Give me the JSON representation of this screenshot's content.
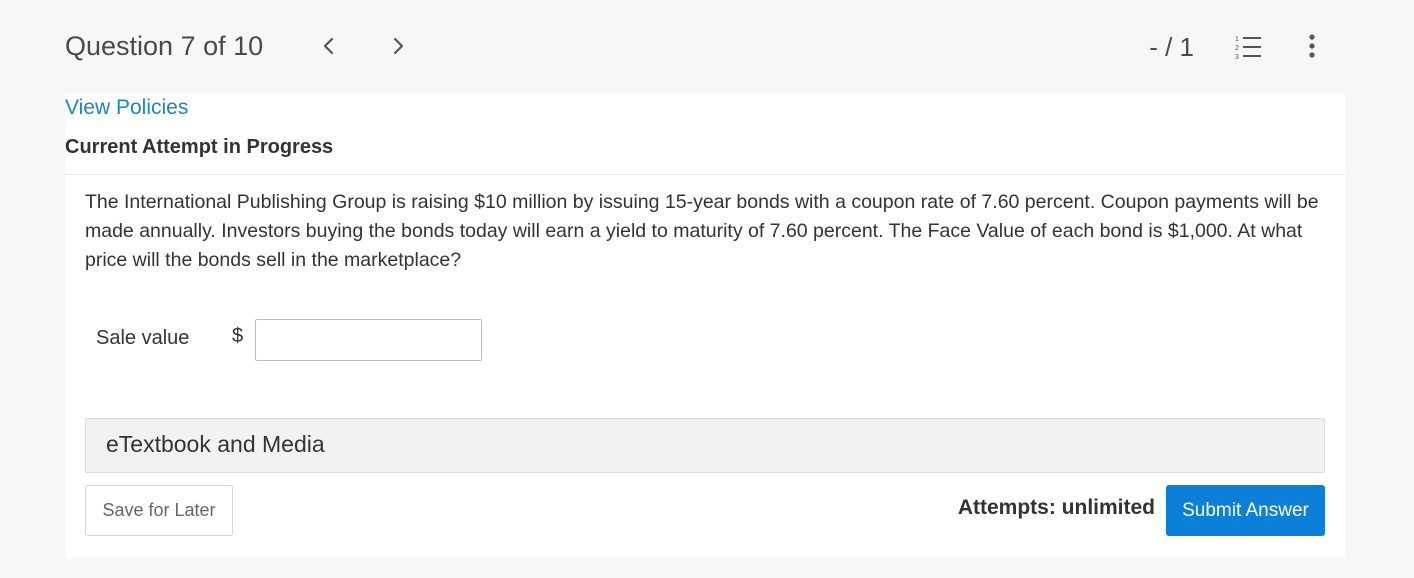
{
  "header": {
    "question_title": "Question 7 of 10",
    "score": "- / 1"
  },
  "panel": {
    "policies_link": "View Policies",
    "attempt_heading": "Current Attempt in Progress",
    "question_text": "The International Publishing Group is raising $10 million by issuing 15-year bonds with a coupon rate of 7.60 percent. Coupon payments will be made annually. Investors buying the bonds today will earn a yield to maturity of 7.60 percent. The Face Value of each bond is $1,000. At what price will the bonds sell in the marketplace?",
    "answer": {
      "label": "Sale value",
      "currency": "$",
      "value": ""
    },
    "etextbook_label": "eTextbook and Media",
    "save_label": "Save for Later",
    "attempts_text": "Attempts: unlimited",
    "submit_label": "Submit Answer"
  },
  "colors": {
    "link": "#1a85c8",
    "primary_button": "#0c7fd9",
    "page_background": "#f7f7f7"
  },
  "icons": {
    "prev": "chevron-left-icon",
    "next": "chevron-right-icon",
    "question_list": "numbered-list-icon",
    "more": "more-vertical-icon"
  }
}
